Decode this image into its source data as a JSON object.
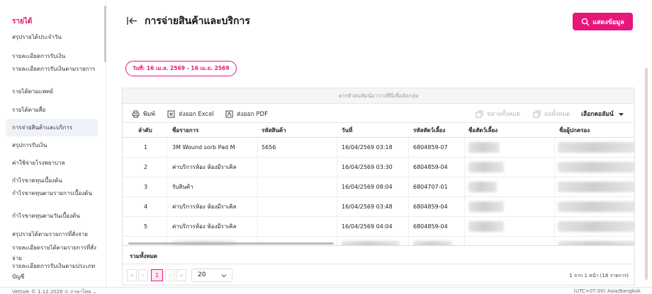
{
  "sidebar": {
    "section_title": "รายได้",
    "items": [
      {
        "label": "สรุปรายได้ประจำวัน"
      },
      {
        "label": "รายละเอียดการรับเงิน"
      },
      {
        "label": "รายละเอียดการรับเงินตามรายการ"
      },
      {
        "label": "รายได้ตามแพทย์"
      },
      {
        "label": "รายได้ตามสื่อ"
      },
      {
        "label": "การจ่ายสินค้าและบริการ"
      },
      {
        "label": "สรุปการรับเงิน"
      },
      {
        "label": "ค่าใช้จ่ายโรงพยาบาล"
      },
      {
        "label": "กำไรขาดทุนเบื้องต้น"
      },
      {
        "label": "กำไรขาดทุนตามรายการเบื้องต้น"
      },
      {
        "label": "กำไรขาดทุนตามวันเบื้องต้น"
      },
      {
        "label": "สรุปรายได้ตามรายการที่สั่งจ่าย"
      },
      {
        "label": "รายละเอียดรายได้ตามรายการที่สั่งจ่าย"
      },
      {
        "label": "รายละเอียดการรับเงินตามประเภทบัญชี"
      }
    ]
  },
  "header": {
    "title": "การจ่ายสินค้าและบริการ",
    "show_button": "แสดงข้อมูล"
  },
  "filter": {
    "date_range": "วันที่: 16 เม.ย. 2569 - 16 เม.ย. 2569"
  },
  "grid": {
    "group_hint": "ลากหัวคอลัมน์มาวางที่นี่เพื่อจัดกลุ่ม",
    "toolbar": {
      "print": "พิมพ์",
      "export_excel": "ส่งออก Excel",
      "export_pdf": "ส่งออก PDF",
      "expand_all": "ขยายทั้งหมด",
      "collapse_all": "ย่อทั้งหมด",
      "choose_columns": "เลือกคอลัมน์"
    },
    "columns": [
      "ลำดับ",
      "ชื่อรายการ",
      "รหัสสินค้า",
      "วันที่",
      "รหัสสัตว์เลี้ยง",
      "ชื่อสัตว์เลี้ยง",
      "ชื่อผู้ปกครอง"
    ],
    "rows": [
      {
        "no": "1",
        "item": "3M Wound sorb Pad M",
        "code": "5656",
        "date": "16/04/2569 03:18",
        "pet_id": "6804859-07"
      },
      {
        "no": "2",
        "item": "ค่าบริการห้อง ห้องมีราเคิล",
        "code": "",
        "date": "16/04/2569 03:30",
        "pet_id": "6804859-04"
      },
      {
        "no": "3",
        "item": "รับสินค้า",
        "code": "",
        "date": "16/04/2569 08:04",
        "pet_id": "6804707-01"
      },
      {
        "no": "4",
        "item": "ค่าบริการห้อง ห้องมีราเคิล",
        "code": "",
        "date": "16/04/2569 03:48",
        "pet_id": "6804859-04"
      },
      {
        "no": "5",
        "item": "ค่าบริการห้อง ห้องมีราเคิล",
        "code": "",
        "date": "16/04/2569 04:04",
        "pet_id": "6804859-04"
      }
    ],
    "summary_label": "รวมทั้งหมด"
  },
  "pager": {
    "first": "«",
    "prev": "‹",
    "current_page": "1",
    "next": "›",
    "last": "»",
    "page_size": "20",
    "info": "1 จาก 1 หน้า (18 รายการ)"
  },
  "footer": {
    "left": "Vettale © 1.12.2026 ⊙ ภาษาไทย ⌄",
    "right": "(UTC+07:00) Asia/Bangkok"
  },
  "colors": {
    "accent": "#e8157a",
    "active_bg": "#eff3f8"
  }
}
